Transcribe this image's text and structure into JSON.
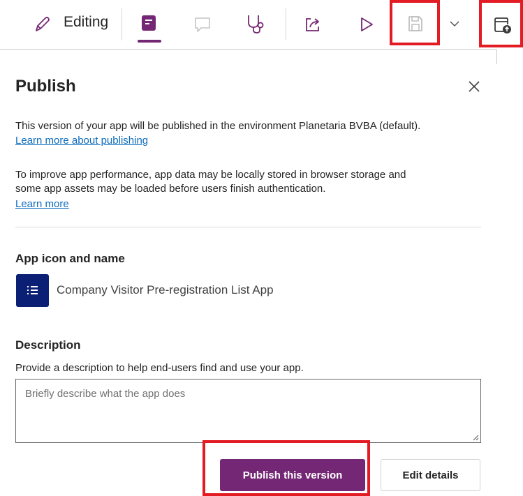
{
  "toolbar": {
    "editing_label": "Editing",
    "icons": [
      "edit-pencil-icon",
      "app-notes-icon",
      "comment-icon",
      "app-checker-icon",
      "share-icon",
      "play-icon",
      "save-icon",
      "chevron-down-icon",
      "publish-icon"
    ]
  },
  "panel": {
    "title": "Publish",
    "env_text": "This version of your app will be published in the environment Planetaria BVBA (default).",
    "learn_publishing": "Learn more about publishing",
    "perf_text_line1": "To improve app performance, app data may be locally stored in browser storage and",
    "perf_text_line2": "some app assets may be loaded before users finish authentication.",
    "learn_more": "Learn more",
    "app_section_label": "App icon and name",
    "app_name": "Company Visitor Pre-registration List App",
    "description_label": "Description",
    "description_hint": "Provide a description to help end-users find and use your app.",
    "description_placeholder": "Briefly describe what the app does",
    "description_value": "",
    "publish_button": "Publish this version",
    "edit_details_button": "Edit details"
  },
  "colors": {
    "accent": "#742774",
    "highlight": "#e31b23",
    "link": "#0f6cbd",
    "app_tile": "#0b1f74"
  }
}
